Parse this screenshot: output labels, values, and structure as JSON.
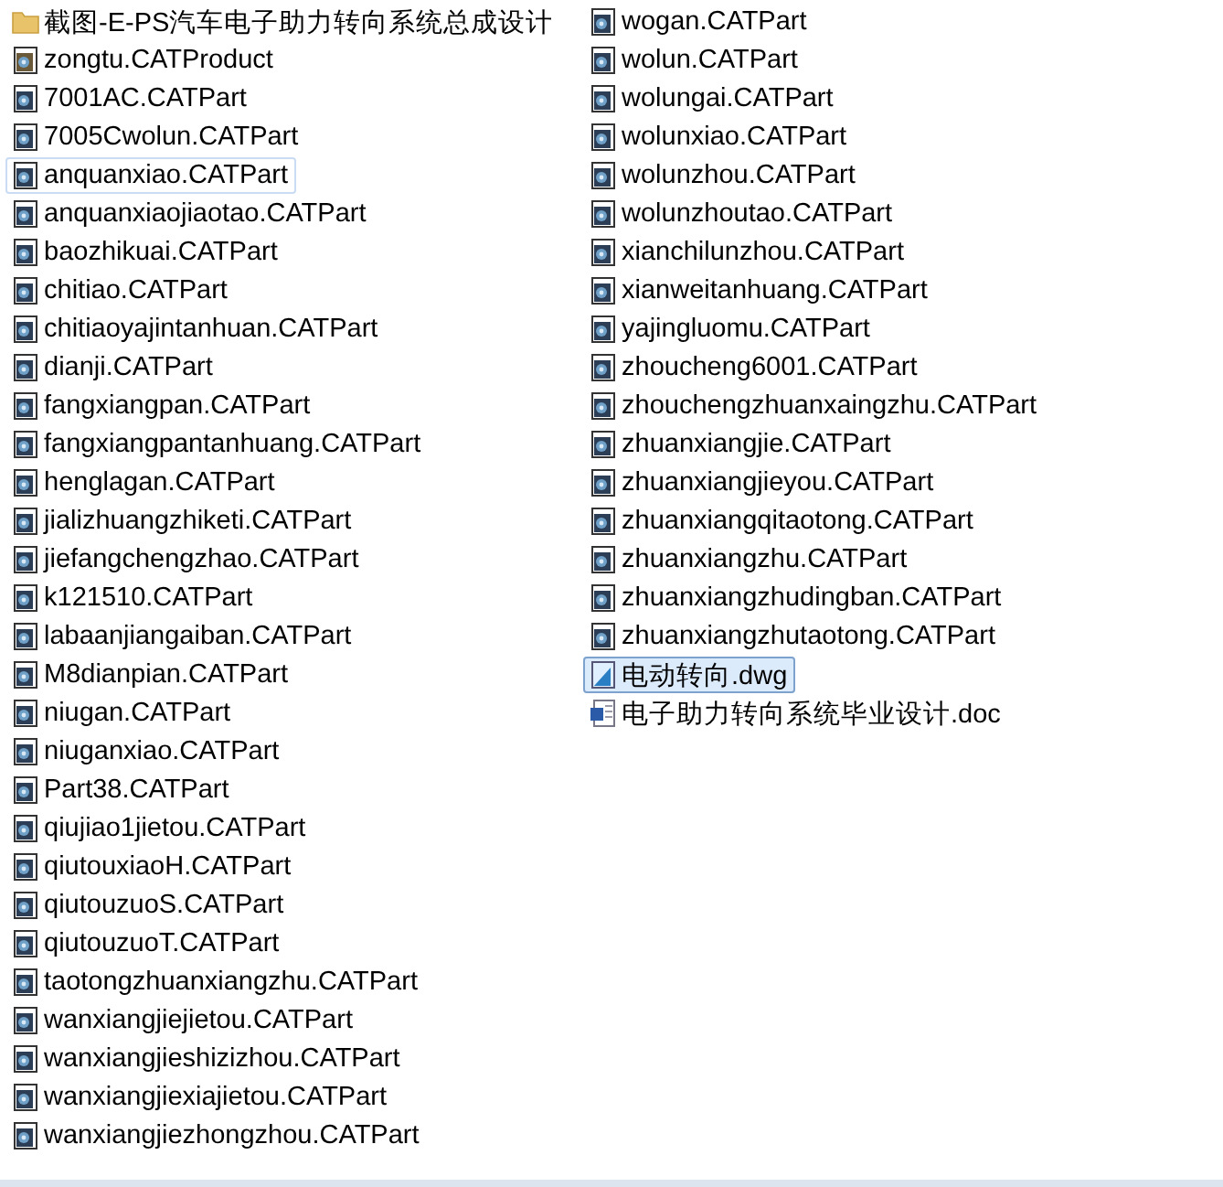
{
  "files": [
    {
      "name": "截图-E-PS汽车电子助力转向系统总成设计",
      "kind": "folder",
      "selected": false,
      "focused": false
    },
    {
      "name": "zongtu.CATProduct",
      "kind": "catproduct",
      "selected": false,
      "focused": false
    },
    {
      "name": "7001AC.CATPart",
      "kind": "catpart",
      "selected": false,
      "focused": false
    },
    {
      "name": "7005Cwolun.CATPart",
      "kind": "catpart",
      "selected": false,
      "focused": false
    },
    {
      "name": "anquanxiao.CATPart",
      "kind": "catpart",
      "selected": false,
      "focused": true
    },
    {
      "name": "anquanxiaojiaotao.CATPart",
      "kind": "catpart",
      "selected": false,
      "focused": false
    },
    {
      "name": "baozhikuai.CATPart",
      "kind": "catpart",
      "selected": false,
      "focused": false
    },
    {
      "name": "chitiao.CATPart",
      "kind": "catpart",
      "selected": false,
      "focused": false
    },
    {
      "name": "chitiaoyajintanhuan.CATPart",
      "kind": "catpart",
      "selected": false,
      "focused": false
    },
    {
      "name": "dianji.CATPart",
      "kind": "catpart",
      "selected": false,
      "focused": false
    },
    {
      "name": "fangxiangpan.CATPart",
      "kind": "catpart",
      "selected": false,
      "focused": false
    },
    {
      "name": "fangxiangpantanhuang.CATPart",
      "kind": "catpart",
      "selected": false,
      "focused": false
    },
    {
      "name": "henglagan.CATPart",
      "kind": "catpart",
      "selected": false,
      "focused": false
    },
    {
      "name": "jializhuangzhiketi.CATPart",
      "kind": "catpart",
      "selected": false,
      "focused": false
    },
    {
      "name": "jiefangchengzhao.CATPart",
      "kind": "catpart",
      "selected": false,
      "focused": false
    },
    {
      "name": "k121510.CATPart",
      "kind": "catpart",
      "selected": false,
      "focused": false
    },
    {
      "name": "labaanjiangaiban.CATPart",
      "kind": "catpart",
      "selected": false,
      "focused": false
    },
    {
      "name": "M8dianpian.CATPart",
      "kind": "catpart",
      "selected": false,
      "focused": false
    },
    {
      "name": "niugan.CATPart",
      "kind": "catpart",
      "selected": false,
      "focused": false
    },
    {
      "name": "niuganxiao.CATPart",
      "kind": "catpart",
      "selected": false,
      "focused": false
    },
    {
      "name": "Part38.CATPart",
      "kind": "catpart",
      "selected": false,
      "focused": false
    },
    {
      "name": "qiujiao1jietou.CATPart",
      "kind": "catpart",
      "selected": false,
      "focused": false
    },
    {
      "name": "qiutouxiaoH.CATPart",
      "kind": "catpart",
      "selected": false,
      "focused": false
    },
    {
      "name": "qiutouzuoS.CATPart",
      "kind": "catpart",
      "selected": false,
      "focused": false
    },
    {
      "name": "qiutouzuoT.CATPart",
      "kind": "catpart",
      "selected": false,
      "focused": false
    },
    {
      "name": "taotongzhuanxiangzhu.CATPart",
      "kind": "catpart",
      "selected": false,
      "focused": false
    },
    {
      "name": "wanxiangjiejietou.CATPart",
      "kind": "catpart",
      "selected": false,
      "focused": false
    },
    {
      "name": "wanxiangjieshizizhou.CATPart",
      "kind": "catpart",
      "selected": false,
      "focused": false
    },
    {
      "name": "wanxiangjiexiajietou.CATPart",
      "kind": "catpart",
      "selected": false,
      "focused": false
    },
    {
      "name": "wanxiangjiezhongzhou.CATPart",
      "kind": "catpart",
      "selected": false,
      "focused": false
    },
    {
      "name": "wogan.CATPart",
      "kind": "catpart",
      "selected": false,
      "focused": false
    },
    {
      "name": "wolun.CATPart",
      "kind": "catpart",
      "selected": false,
      "focused": false
    },
    {
      "name": "wolungai.CATPart",
      "kind": "catpart",
      "selected": false,
      "focused": false
    },
    {
      "name": "wolunxiao.CATPart",
      "kind": "catpart",
      "selected": false,
      "focused": false
    },
    {
      "name": "wolunzhou.CATPart",
      "kind": "catpart",
      "selected": false,
      "focused": false
    },
    {
      "name": "wolunzhoutao.CATPart",
      "kind": "catpart",
      "selected": false,
      "focused": false
    },
    {
      "name": "xianchilunzhou.CATPart",
      "kind": "catpart",
      "selected": false,
      "focused": false
    },
    {
      "name": "xianweitanhuang.CATPart",
      "kind": "catpart",
      "selected": false,
      "focused": false
    },
    {
      "name": "yajingluomu.CATPart",
      "kind": "catpart",
      "selected": false,
      "focused": false
    },
    {
      "name": "zhoucheng6001.CATPart",
      "kind": "catpart",
      "selected": false,
      "focused": false
    },
    {
      "name": "zhouchengzhuanxaingzhu.CATPart",
      "kind": "catpart",
      "selected": false,
      "focused": false
    },
    {
      "name": "zhuanxiangjie.CATPart",
      "kind": "catpart",
      "selected": false,
      "focused": false
    },
    {
      "name": "zhuanxiangjieyou.CATPart",
      "kind": "catpart",
      "selected": false,
      "focused": false
    },
    {
      "name": "zhuanxiangqitaotong.CATPart",
      "kind": "catpart",
      "selected": false,
      "focused": false
    },
    {
      "name": "zhuanxiangzhu.CATPart",
      "kind": "catpart",
      "selected": false,
      "focused": false
    },
    {
      "name": "zhuanxiangzhudingban.CATPart",
      "kind": "catpart",
      "selected": false,
      "focused": false
    },
    {
      "name": "zhuanxiangzhutaotong.CATPart",
      "kind": "catpart",
      "selected": false,
      "focused": false
    },
    {
      "name": "电动转向.dwg",
      "kind": "dwg",
      "selected": true,
      "focused": false
    },
    {
      "name": "电子助力转向系统毕业设计.doc",
      "kind": "doc",
      "selected": false,
      "focused": false
    }
  ]
}
